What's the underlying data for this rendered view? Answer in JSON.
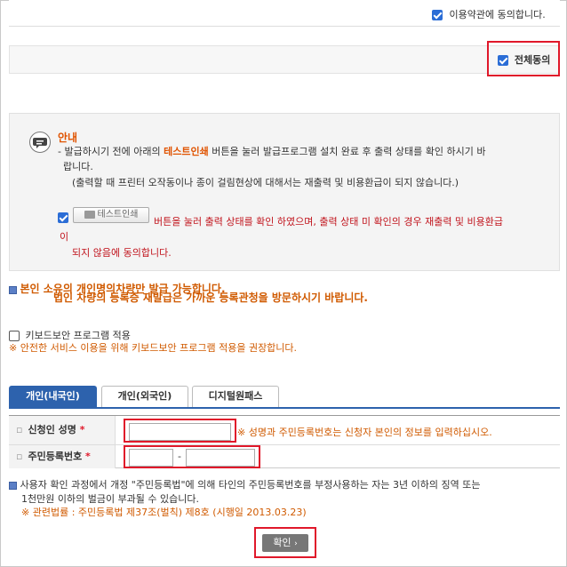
{
  "terms": {
    "agree_label": "이용약관에 동의합니다."
  },
  "all_agree": {
    "label": "전체동의"
  },
  "notice": {
    "title": "안내",
    "line1_pre": "- 발급하시기 전에 아래의 ",
    "line1_highlight": "테스트인쇄",
    "line1_post": " 버튼을 눌러 발급프로그램 설치 완료 후 출력 상태를 확인 하시기 바",
    "line2": "랍니다.",
    "line3": "(출력할 때 프린터 오작동이나 종이 걸림현상에 대해서는 재출력 및 비용환급이 되지 않습니다.)",
    "test_print_button": "테스트인쇄",
    "confirm_text_1": "버튼을 눌러 출력 상태를 확인 하였으며, 출력 상태 미 확인의 경우 재출력 및 비용환급",
    "confirm_text_2": "이",
    "confirm_text_3": "되지 않음에 동의합니다."
  },
  "warning": {
    "line1": "본인 소유의 개인명의차량만 발급 가능합니다.",
    "line2": "법인 차량의 등록증 재발급은 가까운 등록관청을 방문하시기 바랍니다."
  },
  "keyboard": {
    "label": "키보드보안 프로그램 적용",
    "note": "※ 안전한 서비스 이용을 위해 키보드보안 프로그램 적용을 권장합니다."
  },
  "tabs": [
    {
      "label": "개인(내국인)"
    },
    {
      "label": "개인(외국인)"
    },
    {
      "label": "디지털원패스"
    }
  ],
  "form": {
    "name_label": "신청인 성명",
    "name_required": "*",
    "name_hint": "※ 성명과 주민등록번호는 신청자 본인의 정보를 입력하십시오.",
    "rrn_label": "주민등록번호",
    "rrn_required": "*",
    "rrn_dash": "-"
  },
  "legal": {
    "line1": "사용자 확인 과정에서 개정 \"주민등록법\"에 의해 타인의 주민등록번호를 부정사용하는 자는 3년 이하의 징역 또는",
    "line2": "1천만원 이하의 벌금이 부과될 수 있습니다.",
    "line3": "※ 관련법률 : 주민등록법 제37조(벌칙) 제8호 (시행일 2013.03.23)"
  },
  "confirm_button": "확인",
  "colors": {
    "accent": "#2d62ad",
    "highlight_red": "#e0182a",
    "warning_orange": "#d05a00"
  }
}
